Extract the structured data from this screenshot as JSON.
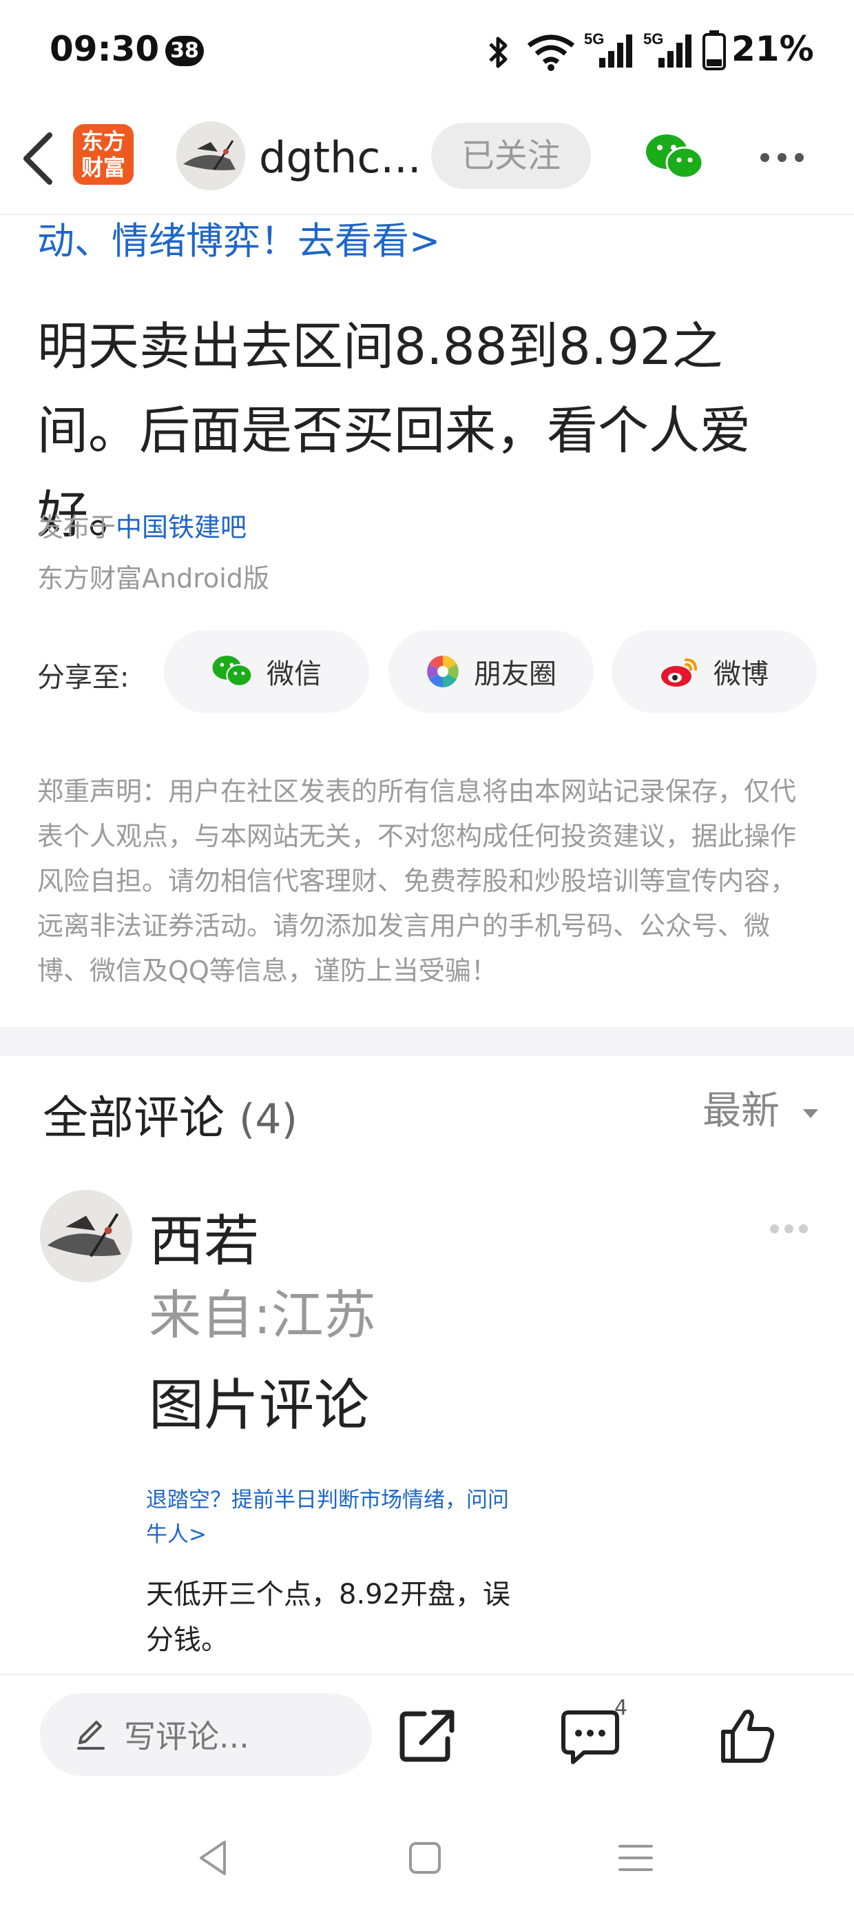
{
  "status_bar": {
    "time": "09:30",
    "notification_count": "38",
    "battery": "21%",
    "network": "5G"
  },
  "header": {
    "logo_line1": "东方",
    "logo_line2": "财富",
    "username": "dgthc...",
    "follow_label": "已关注"
  },
  "post": {
    "promo_link": "动、情绪博弈！去看看>",
    "content": "明天卖出去区间8.88到8.92之间。后面是否买回来，看个人爱好。",
    "posted_prefix": "发布于",
    "posted_forum": "中国铁建吧",
    "client": "东方财富Android版"
  },
  "share": {
    "label": "分享至:",
    "wechat": "微信",
    "moments": "朋友圈",
    "weibo": "微博"
  },
  "disclaimer": "郑重声明：用户在社区发表的所有信息将由本网站记录保存，仅代表个人观点，与本网站无关，不对您构成任何投资建议，据此操作风险自担。请勿相信代客理财、免费荐股和炒股培训等宣传内容，远离非法证券活动。请勿添加发言用户的手机号码、公众号、微博、微信及QQ等信息，谨防上当受骗！",
  "comments": {
    "title": "全部评论",
    "count": "(4)",
    "sort": "最新",
    "items": [
      {
        "name": "西若",
        "location": "来自:江苏",
        "body": "图片评论",
        "embed_link_line1": "退踏空？提前半日判断市场情绪，问问",
        "embed_link_line2": "牛人>",
        "embed_text": "天低开三个点，8.92开盘，误分钱。"
      }
    ]
  },
  "toolbar": {
    "comment_placeholder": "写评论...",
    "comment_badge": "4"
  },
  "colors": {
    "brand": "#ef5a21",
    "link": "#1e66c9",
    "wechat": "#1aad19",
    "weibo": "#e6162d"
  }
}
